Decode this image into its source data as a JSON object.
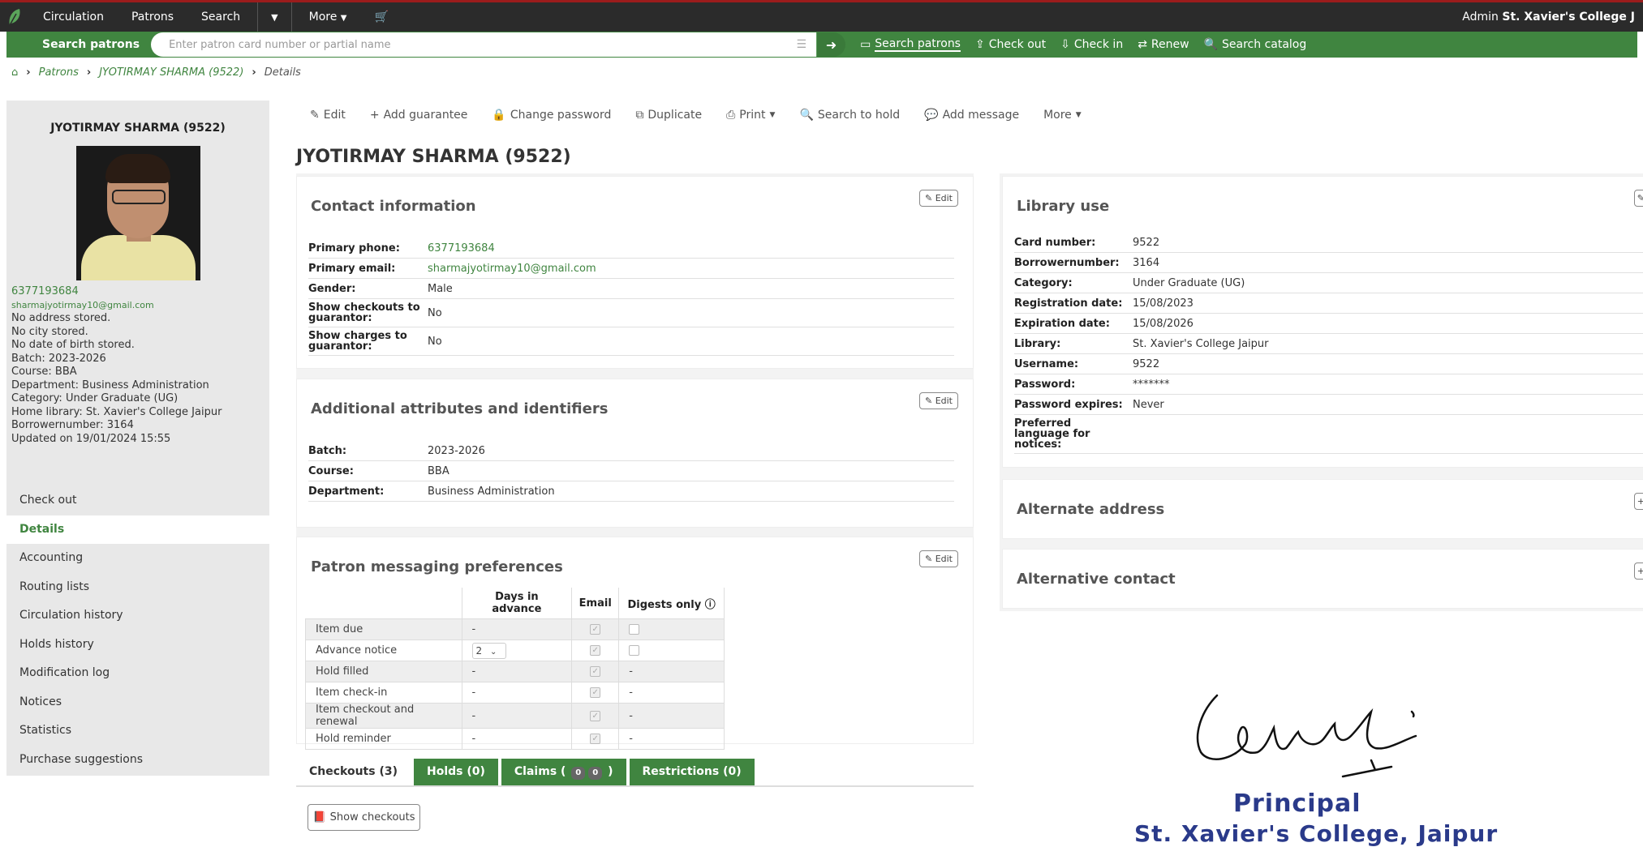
{
  "nav": {
    "items": [
      "Circulation",
      "Patrons",
      "Search",
      "More"
    ],
    "right_prefix": "Admin",
    "right_library": "St. Xavier's College J"
  },
  "searchbar": {
    "label": "Search patrons",
    "placeholder": "Enter patron card number or partial name",
    "tabs": [
      "Search patrons",
      "Check out",
      "Check in",
      "Renew",
      "Search catalog"
    ]
  },
  "breadcrumb": {
    "patrons": "Patrons",
    "patron": "JYOTIRMAY SHARMA (9522)",
    "current": "Details"
  },
  "sidebar": {
    "name": "JYOTIRMAY SHARMA (9522)",
    "phone": "6377193684",
    "email": "sharmajyotirmay10@gmail.com",
    "lines": [
      "No address stored.",
      "No city stored.",
      "No date of birth stored.",
      "Batch: 2023-2026",
      "Course: BBA",
      "Department: Business Administration",
      "Category: Under Graduate (UG)",
      "Home library: St. Xavier's College Jaipur",
      "Borrowernumber: 3164",
      "Updated on 19/01/2024 15:55"
    ],
    "menu": [
      "Check out",
      "Details",
      "Accounting",
      "Routing lists",
      "Circulation history",
      "Holds history",
      "Modification log",
      "Notices",
      "Statistics",
      "Purchase suggestions"
    ],
    "active_menu": "Details"
  },
  "toolbar": [
    "Edit",
    "Add guarantee",
    "Change password",
    "Duplicate",
    "Print",
    "Search to hold",
    "Add message",
    "More"
  ],
  "page_title": "JYOTIRMAY SHARMA (9522)",
  "edit_label": "Edit",
  "contact": {
    "title": "Contact information",
    "rows": [
      {
        "label": "Primary phone:",
        "value": "6377193684"
      },
      {
        "label": "Primary email:",
        "value": "sharmajyotirmay10@gmail.com"
      },
      {
        "label": "Gender:",
        "value": "Male"
      },
      {
        "label": "Show checkouts to guarantor:",
        "value": "No"
      },
      {
        "label": "Show charges to guarantor:",
        "value": "No"
      }
    ]
  },
  "attributes": {
    "title": "Additional attributes and identifiers",
    "rows": [
      {
        "label": "Batch:",
        "value": "2023-2026"
      },
      {
        "label": "Course:",
        "value": "BBA"
      },
      {
        "label": "Department:",
        "value": "Business Administration"
      }
    ]
  },
  "messaging": {
    "title": "Patron messaging preferences",
    "headers": [
      "Days in advance",
      "Email",
      "Digests only"
    ],
    "rows": [
      {
        "name": "Item due",
        "days": "-",
        "email": "checked",
        "digest": "empty"
      },
      {
        "name": "Advance notice",
        "days": "2",
        "email": "checked",
        "digest": "empty"
      },
      {
        "name": "Hold filled",
        "days": "-",
        "email": "checked",
        "digest": "-"
      },
      {
        "name": "Item check-in",
        "days": "-",
        "email": "checked",
        "digest": "-"
      },
      {
        "name": "Item checkout and renewal",
        "days": "-",
        "email": "checked",
        "digest": "-"
      },
      {
        "name": "Hold reminder",
        "days": "-",
        "email": "checked",
        "digest": "-"
      }
    ]
  },
  "library_use": {
    "title": "Library use",
    "rows": [
      {
        "label": "Card number:",
        "value": "9522"
      },
      {
        "label": "Borrowernumber:",
        "value": "3164"
      },
      {
        "label": "Category:",
        "value": "Under Graduate (UG)"
      },
      {
        "label": "Registration date:",
        "value": "15/08/2023"
      },
      {
        "label": "Expiration date:",
        "value": "15/08/2026"
      },
      {
        "label": "Library:",
        "value": "St. Xavier's College Jaipur"
      },
      {
        "label": "Username:",
        "value": "9522"
      },
      {
        "label": "Password:",
        "value": "*******"
      },
      {
        "label": "Password expires:",
        "value": "Never"
      },
      {
        "label": "Preferred language for notices:",
        "value": ""
      }
    ]
  },
  "alternate_address": {
    "title": "Alternate address"
  },
  "alternative_contact": {
    "title": "Alternative contact"
  },
  "tabs": {
    "checkouts": "Checkouts (3)",
    "holds": "Holds (0)",
    "claims_prefix": "Claims (",
    "claims_a": "0",
    "claims_b": "0",
    "claims_suffix": ")",
    "restrictions": "Restrictions (0)"
  },
  "show_checkouts": "Show checkouts",
  "stamp": {
    "signature": "signature",
    "principal": "Principal",
    "college": "St. Xavier's College, Jaipur"
  },
  "colors": {
    "green": "#408540",
    "navbar": "#2b2b2b",
    "accent_red": "#9b1c1c",
    "stamp_blue": "#2a3a8a"
  }
}
